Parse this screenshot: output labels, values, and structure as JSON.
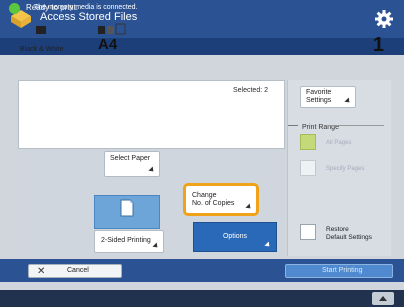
{
  "window": {
    "title": "Access Stored Files",
    "settings_icon": "gear-icon",
    "app_icon": "access-stored-files-icon"
  },
  "status": {
    "text": "Ready to print.",
    "color": "#5ac73f"
  },
  "summary": {
    "selected_label": "Selected: 2",
    "color_mode": "Black & White",
    "paper_size": "A4",
    "copies": "1"
  },
  "buttons": {
    "select_paper": "Select Paper",
    "change_copies_line1": "Change",
    "change_copies_line2": "No. of Copies",
    "two_sided": "2-Sided Printing",
    "options": "Options",
    "favorite_line1": "Favorite",
    "favorite_line2": "Settings",
    "restore_line1": "Restore",
    "restore_line2": "Default Settings",
    "cancel": "Cancel",
    "start": "Start Printing"
  },
  "print_range": {
    "title": "Print Range",
    "all_pages": "All Pages",
    "specify_pages": "Specify Pages"
  },
  "footer": {
    "text": "The memory media is connected."
  },
  "colors": {
    "title_bar": "#2b5394",
    "highlight": "#f0a31a",
    "options_button": "#2a69b8"
  }
}
